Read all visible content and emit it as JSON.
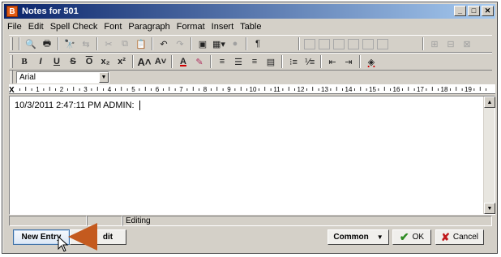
{
  "window": {
    "title": "Notes for 501",
    "app_icon": "app-logo-icon",
    "buttons": [
      "minimize-icon",
      "maximize-icon",
      "close-icon"
    ]
  },
  "menu": [
    "File",
    "Edit",
    "Spell Check",
    "Font",
    "Paragraph",
    "Format",
    "Insert",
    "Table"
  ],
  "font": {
    "selected": "Arial"
  },
  "ruler": {
    "numbers": [
      "1",
      "2",
      "3",
      "4",
      "5",
      "6",
      "7",
      "8",
      "9",
      "10",
      "11",
      "12",
      "13",
      "14",
      "15",
      "16",
      "17",
      "18",
      "19"
    ]
  },
  "editor": {
    "text": "10/3/2011 2:47:11 PM ADMIN:"
  },
  "statusbar": {
    "pane1": "",
    "pane2": "",
    "pane3": "Editing"
  },
  "buttons": {
    "new_entry": "New Entry",
    "edit": "dit",
    "common": "Common",
    "ok": "OK",
    "cancel": "Cancel"
  },
  "colors": {
    "title_gradient_start": "#0a246a",
    "title_gradient_end": "#a6caf0",
    "callout_arrow": "#c45a1e",
    "ok_check": "#2e8b22",
    "cancel_x": "#c0181b"
  }
}
